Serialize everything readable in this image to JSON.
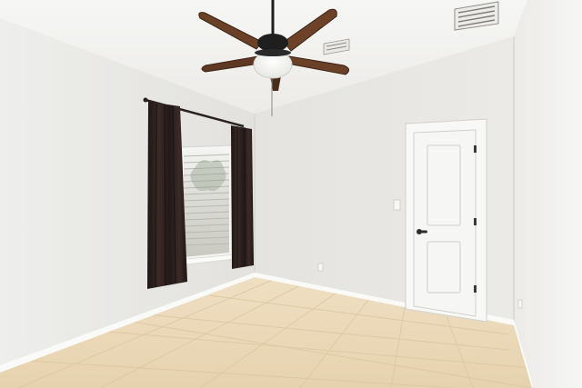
{
  "scene": {
    "subject": "empty-room-interior",
    "icons": [
      "ceiling-fan-icon",
      "air-vent-icon",
      "door-icon",
      "window-icon"
    ]
  },
  "colors": {
    "ceiling": "#f3f3f1",
    "left_wall": "#ecebe8",
    "back_wall": "#e7e6e2",
    "right_wall": "#f1f1ef",
    "floor_tile": "#ebd9b8",
    "grout": "#d8c39f",
    "curtain": "#2b1f1c",
    "fan_blade": "#6a4027",
    "door": "#f6f6f4",
    "baseboard": "#fbfbf9"
  }
}
